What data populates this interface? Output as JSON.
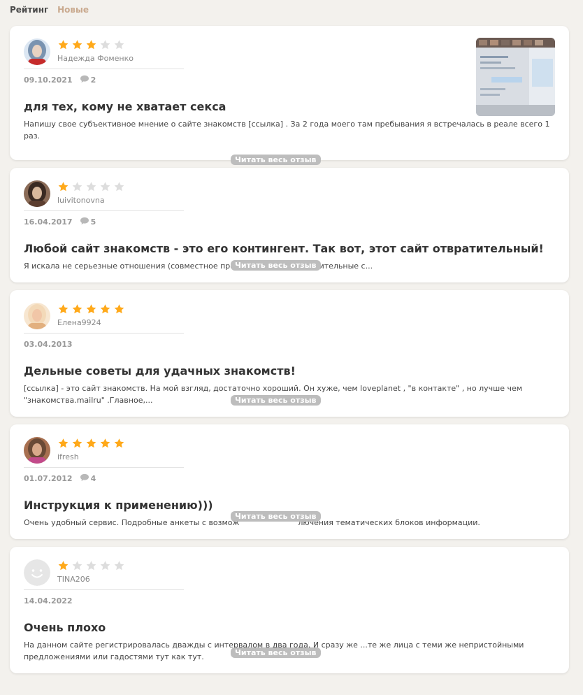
{
  "tabs": {
    "rating": "Рейтинг",
    "new": "Новые"
  },
  "read_more_label": "Читать весь отзыв",
  "colors": {
    "star_active": "#ffa91a",
    "star_inactive": "#dddddd",
    "read_more_bg": "#bdbdbd",
    "tab_inactive": "#c9a98e"
  },
  "reviews": [
    {
      "author": "Надежда Фоменко",
      "rating": 3,
      "date": "09.10.2021",
      "comments": "2",
      "title": "для тех, кому не хватает секса",
      "snippet_line1": "Напишу свое субъективное мнение о сайте знакомств [ссылка] . За 2 года моего там пребывания я встречалась в реале всего 1",
      "snippet_line2": "раз.",
      "has_image": true,
      "avatar": "photo-woman"
    },
    {
      "author": "luivitonovna",
      "rating": 1,
      "date": "16.04.2017",
      "comments": "5",
      "title": "Любой сайт знакомств - это его контингент. Так вот, этот сайт отвратительный!",
      "snippet_line1": "Я искала не серьезные отношения (совместное прож               просто длительные с...",
      "snippet_line2": "",
      "has_image": false,
      "avatar": "photo-woman-dark"
    },
    {
      "author": "Елена9924",
      "rating": 5,
      "date": "03.04.2013",
      "comments": "",
      "title": "Дельные советы для удачных знакомств!",
      "snippet_line1": "[ссылка] - это сайт знакомств. На мой взгляд, достаточно хороший. Он хуже, чем loveplanet , \"в контакте\" , но лучше чем",
      "snippet_line2": "\"знакомства.mailru\" .Главное,...",
      "has_image": false,
      "avatar": "photo-woman-blonde"
    },
    {
      "author": "ifresh",
      "rating": 5,
      "date": "01.07.2012",
      "comments": "4",
      "title": "Инструкция к применению)))",
      "snippet_line1": "Очень удобный сервис. Подробные анкеты с возмож                        лючения тематических блоков информации.",
      "snippet_line2": "",
      "has_image": false,
      "avatar": "photo-woman-curly"
    },
    {
      "author": "TINA206",
      "rating": 1,
      "date": "14.04.2022",
      "comments": "",
      "title": "Очень плохо",
      "snippet_line1": "На данном сайте регистрировалась дважды с интервалом в два года. И сразу же ...те же лица с теми же непристойными",
      "snippet_line2": "предложениями или гадостями тут как тут.",
      "has_image": false,
      "avatar": "default-smiley"
    }
  ]
}
